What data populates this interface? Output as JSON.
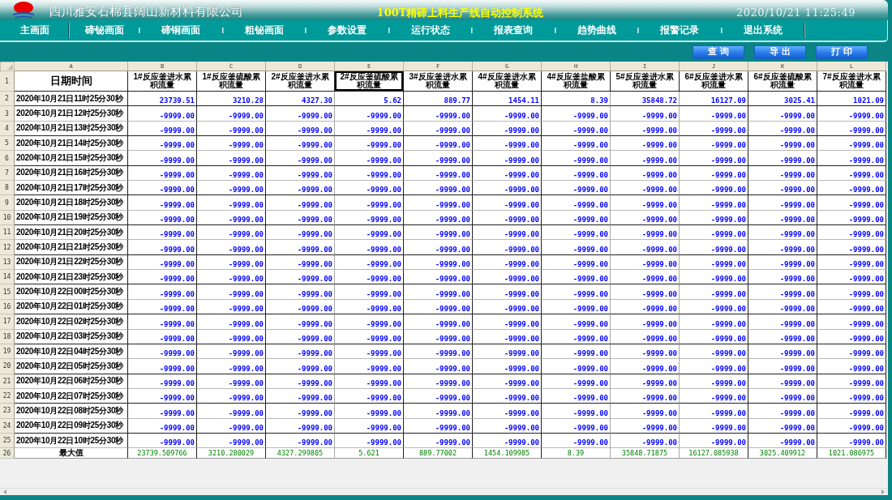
{
  "title_bar": {
    "company": "四川雅安石棉县阔山新材料有限公司",
    "system_title": "100T精碲上料生产线自动控制系统",
    "datetime": "2020/10/21 11:25:49"
  },
  "nav": [
    {
      "label": "主画面"
    },
    {
      "label": "碲铋画面"
    },
    {
      "label": "碲铜画面"
    },
    {
      "label": "粗铋画面"
    },
    {
      "label": "参数设置"
    },
    {
      "label": "运行状态"
    },
    {
      "label": "报表查询"
    },
    {
      "label": "趋势曲线"
    },
    {
      "label": "报警记录"
    },
    {
      "label": "退出系统"
    }
  ],
  "toolbar": {
    "buttons": [
      "查 询",
      "导 出",
      "打 印"
    ]
  },
  "sheet": {
    "column_letters": [
      "A",
      "B",
      "C",
      "D",
      "E",
      "F",
      "G",
      "H",
      "I",
      "J",
      "K",
      "L"
    ],
    "header": {
      "number": "1",
      "cells": [
        {
          "text": "日期时间",
          "selected": false
        },
        {
          "text": "1#反应釜进水累积流量",
          "selected": false
        },
        {
          "text": "1#反应釜硫酸累积流量",
          "selected": false
        },
        {
          "text": "2#反应釜进水累积流量",
          "selected": false
        },
        {
          "text": "2#反应釜硫酸累积流量",
          "selected": true
        },
        {
          "text": "3#反应釜进水累积流量",
          "selected": false
        },
        {
          "text": "4#反应釜进水累积流量",
          "selected": false
        },
        {
          "text": "4#反应釜盐酸累积流量",
          "selected": false
        },
        {
          "text": "5#反应釜进水累积流量",
          "selected": false
        },
        {
          "text": "6#反应釜进水累积流量",
          "selected": false
        },
        {
          "text": "6#反应釜硫酸累积流量",
          "selected": false
        },
        {
          "text": "7#反应釜进水累积流量",
          "selected": false
        }
      ]
    },
    "rows": [
      {
        "number": "2",
        "date": "2020年10月21日11时25分30秒",
        "values": [
          "23739.51",
          "3210.28",
          "4327.30",
          "5.62",
          "889.77",
          "1454.11",
          "8.39",
          "35848.72",
          "16127.09",
          "3025.41",
          "1021.09"
        ]
      },
      {
        "number": "3",
        "date": "2020年10月21日12时25分30秒",
        "values": [
          "-9999.00",
          "-9999.00",
          "-9999.00",
          "-9999.00",
          "-9999.00",
          "-9999.00",
          "-9999.00",
          "-9999.00",
          "-9999.00",
          "-9999.00",
          "-9999.00"
        ]
      },
      {
        "number": "4",
        "date": "2020年10月21日13时25分30秒",
        "values": [
          "-9999.00",
          "-9999.00",
          "-9999.00",
          "-9999.00",
          "-9999.00",
          "-9999.00",
          "-9999.00",
          "-9999.00",
          "-9999.00",
          "-9999.00",
          "-9999.00"
        ]
      },
      {
        "number": "5",
        "date": "2020年10月21日14时25分30秒",
        "values": [
          "-9999.00",
          "-9999.00",
          "-9999.00",
          "-9999.00",
          "-9999.00",
          "-9999.00",
          "-9999.00",
          "-9999.00",
          "-9999.00",
          "-9999.00",
          "-9999.00"
        ]
      },
      {
        "number": "6",
        "date": "2020年10月21日15时25分30秒",
        "values": [
          "-9999.00",
          "-9999.00",
          "-9999.00",
          "-9999.00",
          "-9999.00",
          "-9999.00",
          "-9999.00",
          "-9999.00",
          "-9999.00",
          "-9999.00",
          "-9999.00"
        ]
      },
      {
        "number": "7",
        "date": "2020年10月21日16时25分30秒",
        "values": [
          "-9999.00",
          "-9999.00",
          "-9999.00",
          "-9999.00",
          "-9999.00",
          "-9999.00",
          "-9999.00",
          "-9999.00",
          "-9999.00",
          "-9999.00",
          "-9999.00"
        ]
      },
      {
        "number": "8",
        "date": "2020年10月21日17时25分30秒",
        "values": [
          "-9999.00",
          "-9999.00",
          "-9999.00",
          "-9999.00",
          "-9999.00",
          "-9999.00",
          "-9999.00",
          "-9999.00",
          "-9999.00",
          "-9999.00",
          "-9999.00"
        ]
      },
      {
        "number": "9",
        "date": "2020年10月21日18时25分30秒",
        "values": [
          "-9999.00",
          "-9999.00",
          "-9999.00",
          "-9999.00",
          "-9999.00",
          "-9999.00",
          "-9999.00",
          "-9999.00",
          "-9999.00",
          "-9999.00",
          "-9999.00"
        ]
      },
      {
        "number": "10",
        "date": "2020年10月21日19时25分30秒",
        "values": [
          "-9999.00",
          "-9999.00",
          "-9999.00",
          "-9999.00",
          "-9999.00",
          "-9999.00",
          "-9999.00",
          "-9999.00",
          "-9999.00",
          "-9999.00",
          "-9999.00"
        ]
      },
      {
        "number": "11",
        "date": "2020年10月21日20时25分30秒",
        "values": [
          "-9999.00",
          "-9999.00",
          "-9999.00",
          "-9999.00",
          "-9999.00",
          "-9999.00",
          "-9999.00",
          "-9999.00",
          "-9999.00",
          "-9999.00",
          "-9999.00"
        ]
      },
      {
        "number": "12",
        "date": "2020年10月21日21时25分30秒",
        "values": [
          "-9999.00",
          "-9999.00",
          "-9999.00",
          "-9999.00",
          "-9999.00",
          "-9999.00",
          "-9999.00",
          "-9999.00",
          "-9999.00",
          "-9999.00",
          "-9999.00"
        ]
      },
      {
        "number": "13",
        "date": "2020年10月21日22时25分30秒",
        "values": [
          "-9999.00",
          "-9999.00",
          "-9999.00",
          "-9999.00",
          "-9999.00",
          "-9999.00",
          "-9999.00",
          "-9999.00",
          "-9999.00",
          "-9999.00",
          "-9999.00"
        ]
      },
      {
        "number": "14",
        "date": "2020年10月21日23时25分30秒",
        "values": [
          "-9999.00",
          "-9999.00",
          "-9999.00",
          "-9999.00",
          "-9999.00",
          "-9999.00",
          "-9999.00",
          "-9999.00",
          "-9999.00",
          "-9999.00",
          "-9999.00"
        ]
      },
      {
        "number": "15",
        "date": "2020年10月22日00时25分30秒",
        "values": [
          "-9999.00",
          "-9999.00",
          "-9999.00",
          "-9999.00",
          "-9999.00",
          "-9999.00",
          "-9999.00",
          "-9999.00",
          "-9999.00",
          "-9999.00",
          "-9999.00"
        ]
      },
      {
        "number": "16",
        "date": "2020年10月22日01时25分30秒",
        "values": [
          "-9999.00",
          "-9999.00",
          "-9999.00",
          "-9999.00",
          "-9999.00",
          "-9999.00",
          "-9999.00",
          "-9999.00",
          "-9999.00",
          "-9999.00",
          "-9999.00"
        ]
      },
      {
        "number": "17",
        "date": "2020年10月22日02时25分30秒",
        "values": [
          "-9999.00",
          "-9999.00",
          "-9999.00",
          "-9999.00",
          "-9999.00",
          "-9999.00",
          "-9999.00",
          "-9999.00",
          "-9999.00",
          "-9999.00",
          "-9999.00"
        ]
      },
      {
        "number": "18",
        "date": "2020年10月22日03时25分30秒",
        "values": [
          "-9999.00",
          "-9999.00",
          "-9999.00",
          "-9999.00",
          "-9999.00",
          "-9999.00",
          "-9999.00",
          "-9999.00",
          "-9999.00",
          "-9999.00",
          "-9999.00"
        ]
      },
      {
        "number": "19",
        "date": "2020年10月22日04时25分30秒",
        "values": [
          "-9999.00",
          "-9999.00",
          "-9999.00",
          "-9999.00",
          "-9999.00",
          "-9999.00",
          "-9999.00",
          "-9999.00",
          "-9999.00",
          "-9999.00",
          "-9999.00"
        ]
      },
      {
        "number": "20",
        "date": "2020年10月22日05时25分30秒",
        "values": [
          "-9999.00",
          "-9999.00",
          "-9999.00",
          "-9999.00",
          "-9999.00",
          "-9999.00",
          "-9999.00",
          "-9999.00",
          "-9999.00",
          "-9999.00",
          "-9999.00"
        ]
      },
      {
        "number": "21",
        "date": "2020年10月22日06时25分30秒",
        "values": [
          "-9999.00",
          "-9999.00",
          "-9999.00",
          "-9999.00",
          "-9999.00",
          "-9999.00",
          "-9999.00",
          "-9999.00",
          "-9999.00",
          "-9999.00",
          "-9999.00"
        ]
      },
      {
        "number": "22",
        "date": "2020年10月22日07时25分30秒",
        "values": [
          "-9999.00",
          "-9999.00",
          "-9999.00",
          "-9999.00",
          "-9999.00",
          "-9999.00",
          "-9999.00",
          "-9999.00",
          "-9999.00",
          "-9999.00",
          "-9999.00"
        ]
      },
      {
        "number": "23",
        "date": "2020年10月22日08时25分30秒",
        "values": [
          "-9999.00",
          "-9999.00",
          "-9999.00",
          "-9999.00",
          "-9999.00",
          "-9999.00",
          "-9999.00",
          "-9999.00",
          "-9999.00",
          "-9999.00",
          "-9999.00"
        ]
      },
      {
        "number": "24",
        "date": "2020年10月22日09时25分30秒",
        "values": [
          "-9999.00",
          "-9999.00",
          "-9999.00",
          "-9999.00",
          "-9999.00",
          "-9999.00",
          "-9999.00",
          "-9999.00",
          "-9999.00",
          "-9999.00",
          "-9999.00"
        ]
      },
      {
        "number": "25",
        "date": "2020年10月22日10时25分30秒",
        "values": [
          "-9999.00",
          "-9999.00",
          "-9999.00",
          "-9999.00",
          "-9999.00",
          "-9999.00",
          "-9999.00",
          "-9999.00",
          "-9999.00",
          "-9999.00",
          "-9999.00"
        ]
      }
    ],
    "summary": {
      "number": "26",
      "label": "最大值",
      "values": [
        "23739.509766",
        "3210.280029",
        "4327.299805",
        "5.621",
        "889.77002",
        "1454.109985",
        "8.39",
        "35848.71875",
        "16127.085938",
        "3025.409912",
        "1021.086975"
      ]
    }
  }
}
